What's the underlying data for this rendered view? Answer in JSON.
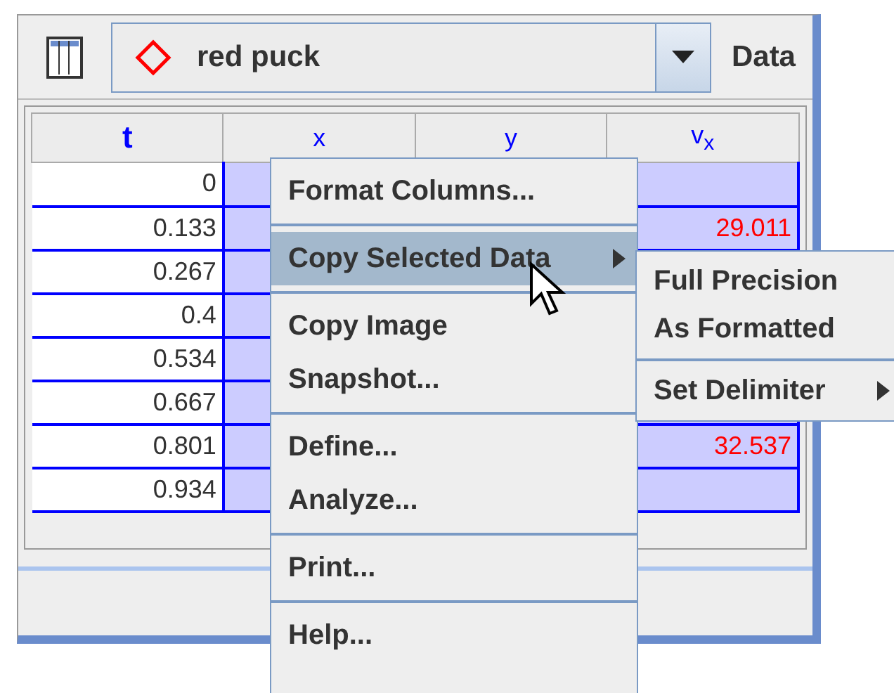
{
  "toolbar": {
    "track_name": "red puck",
    "label": "Data"
  },
  "table": {
    "columns": [
      {
        "label": "t",
        "selected": false
      },
      {
        "label": "x",
        "selected": true
      },
      {
        "label": "y"
      },
      {
        "label": "v$_{x}$",
        "selected": true
      }
    ],
    "rows": [
      {
        "t": "0"
      },
      {
        "t": "0.133",
        "vx": "29.011"
      },
      {
        "t": "0.267"
      },
      {
        "t": "0.4"
      },
      {
        "t": "0.534"
      },
      {
        "t": "0.667"
      },
      {
        "t": "0.801",
        "vx": "32.537"
      },
      {
        "t": "0.934"
      }
    ]
  },
  "context_menu": {
    "groups": [
      {
        "items": [
          {
            "label": "Format Columns...",
            "selected": false,
            "submenu": false
          }
        ]
      },
      {
        "items": [
          {
            "label": "Copy Selected Data",
            "selected": true,
            "submenu": true
          }
        ]
      },
      {
        "items": [
          {
            "label": "Copy Image",
            "selected": false,
            "submenu": false
          },
          {
            "label": "Snapshot...",
            "selected": false,
            "submenu": false
          }
        ]
      },
      {
        "items": [
          {
            "label": "Define...",
            "selected": false,
            "submenu": false
          },
          {
            "label": "Analyze...",
            "selected": false,
            "submenu": false
          }
        ]
      },
      {
        "items": [
          {
            "label": "Print...",
            "selected": false,
            "submenu": false
          }
        ]
      },
      {
        "items": [
          {
            "label": "Help...",
            "selected": false,
            "submenu": false
          }
        ]
      }
    ]
  },
  "submenu": {
    "groups": [
      {
        "items": [
          {
            "label": "Full Precision",
            "selected": false,
            "submenu": false
          },
          {
            "label": "As Formatted",
            "selected": false,
            "submenu": false
          }
        ]
      },
      {
        "items": [
          {
            "label": "Set Delimiter",
            "selected": false,
            "submenu": true
          }
        ]
      }
    ]
  }
}
